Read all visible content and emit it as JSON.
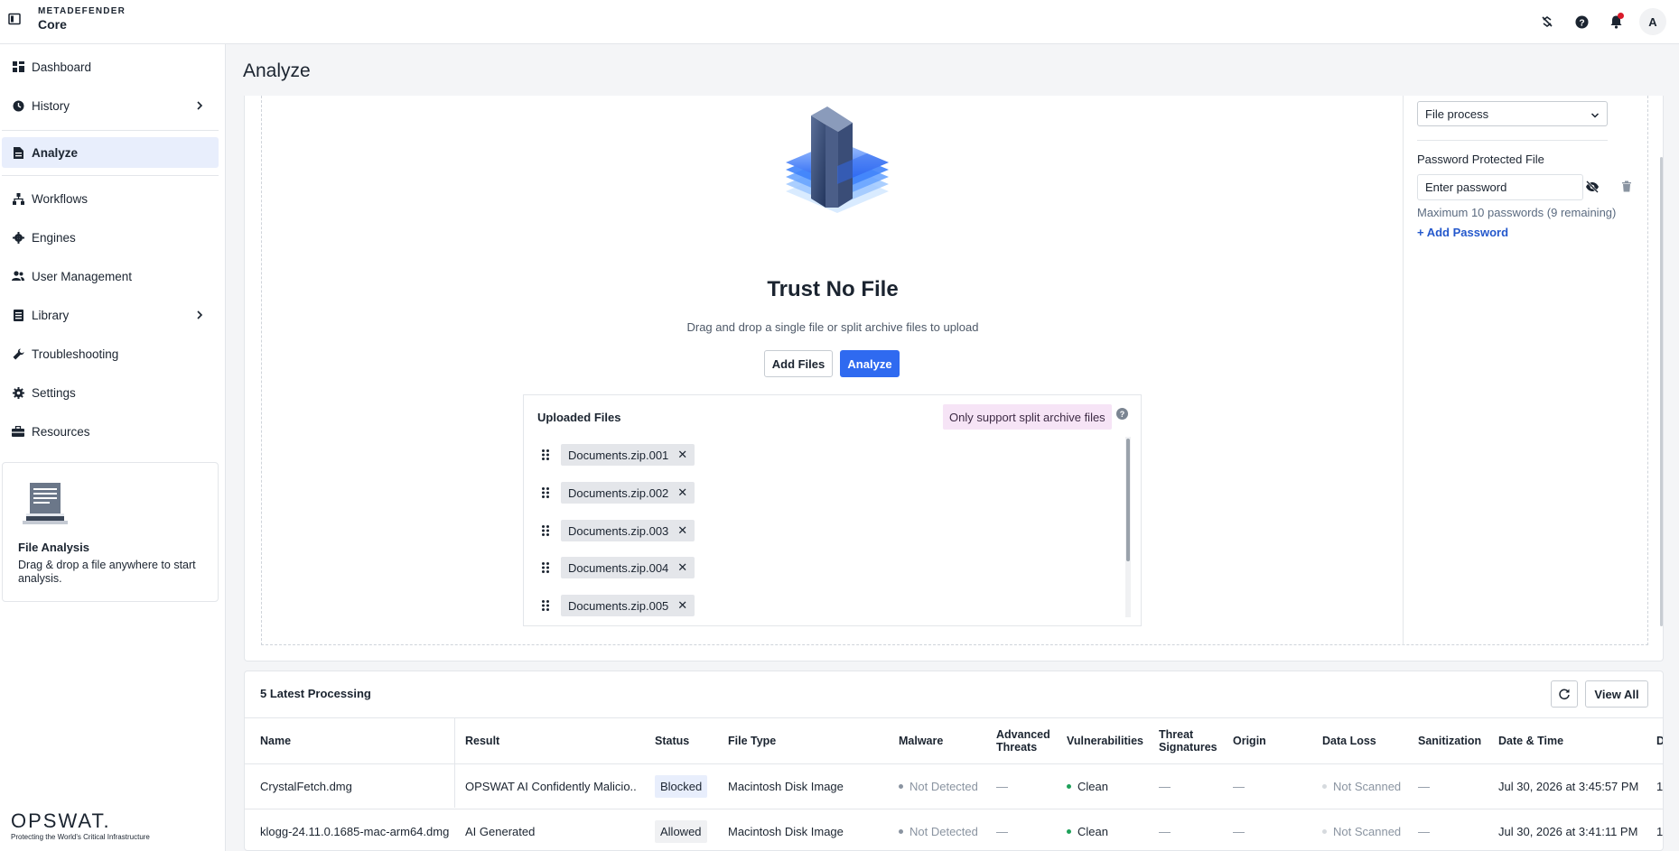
{
  "header": {
    "brand_top": "METADEFENDER",
    "brand_bottom": "Core",
    "avatar_initial": "A"
  },
  "sidebar": {
    "items": [
      {
        "label": "Dashboard",
        "icon": "dashboard-icon"
      },
      {
        "label": "History",
        "icon": "history-icon"
      },
      {
        "label": "Analyze",
        "icon": "analyze-icon"
      },
      {
        "label": "Workflows",
        "icon": "workflows-icon"
      },
      {
        "label": "Engines",
        "icon": "engines-icon"
      },
      {
        "label": "User Management",
        "icon": "users-icon"
      },
      {
        "label": "Library",
        "icon": "library-icon"
      },
      {
        "label": "Troubleshooting",
        "icon": "wrench-icon"
      },
      {
        "label": "Settings",
        "icon": "gear-icon"
      },
      {
        "label": "Resources",
        "icon": "toolbox-icon"
      }
    ],
    "file_analysis": {
      "title": "File Analysis",
      "description": "Drag & drop a file anywhere to start analysis."
    },
    "footer": {
      "logo": "OPSWAT.",
      "tagline": "Protecting the World's Critical Infrastructure"
    }
  },
  "page": {
    "title": "Analyze"
  },
  "upload": {
    "title": "Trust No File",
    "hint": "Drag and drop a single file or split archive files to upload",
    "add_files": "Add Files",
    "analyze": "Analyze",
    "uploaded_title": "Uploaded Files",
    "split_badge": "Only support split archive files",
    "files": [
      "Documents.zip.001",
      "Documents.zip.002",
      "Documents.zip.003",
      "Documents.zip.004",
      "Documents.zip.005"
    ]
  },
  "right_panel": {
    "workflow_select": "File process",
    "password_label": "Password Protected File",
    "password_placeholder": "Enter password",
    "max_passwords": "Maximum 10 passwords (9 remaining)",
    "add_password": "+ Add Password"
  },
  "latest": {
    "title": "5 Latest Processing",
    "view_all": "View All",
    "columns": [
      "Name",
      "Result",
      "Status",
      "File Type",
      "Malware",
      "Advanced Threats",
      "Vulnerabilities",
      "Threat Signatures",
      "Origin",
      "Data Loss",
      "Sanitization",
      "Date & Time",
      "D"
    ],
    "rows": [
      {
        "name": "CrystalFetch.dmg",
        "result": "OPSWAT AI Confidently Malicio...",
        "status": "Blocked",
        "file_type": "Macintosh Disk Image",
        "malware": "Not Detected",
        "advanced_threats": "—",
        "vulnerabilities": "Clean",
        "threat_signatures": "—",
        "origin": "—",
        "data_loss": "Not Scanned",
        "sanitization": "—",
        "date_time": "Jul 30, 2026 at 3:45:57 PM",
        "extra": "1"
      },
      {
        "name": "klogg-24.11.0.1685-mac-arm64.dmg",
        "result": "AI Generated",
        "status": "Allowed",
        "file_type": "Macintosh Disk Image",
        "malware": "Not Detected",
        "advanced_threats": "—",
        "vulnerabilities": "Clean",
        "threat_signatures": "—",
        "origin": "—",
        "data_loss": "Not Scanned",
        "sanitization": "—",
        "date_time": "Jul 30, 2026 at 3:41:11 PM",
        "extra": "1"
      }
    ]
  },
  "colors": {
    "accent": "#2f6af0",
    "active_nav": "#e8eefc",
    "badge_pink": "#f6e4f6",
    "clean_green": "#1fa15a",
    "notif_red": "#d91a2a"
  }
}
